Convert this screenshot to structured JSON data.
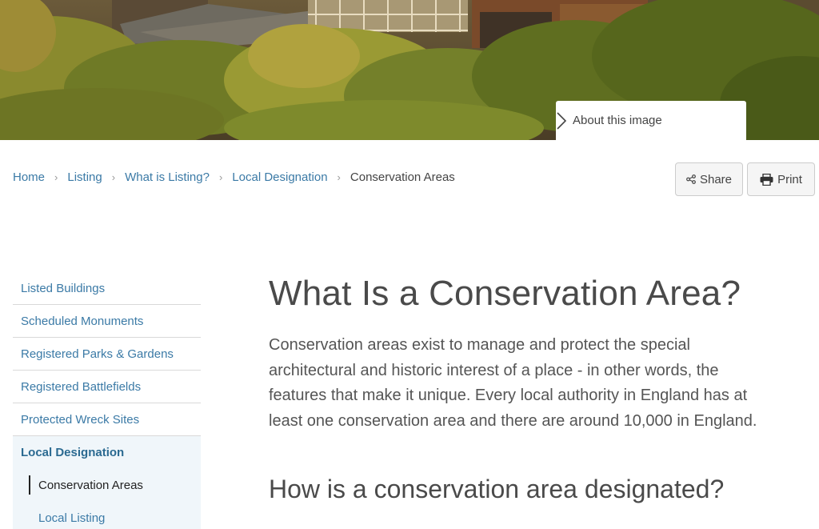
{
  "hero": {
    "about_label": "About this image",
    "chevron_icon": "chevron-right-icon"
  },
  "breadcrumb": {
    "items": [
      "Home",
      "Listing",
      "What is Listing?",
      "Local Designation"
    ],
    "current": "Conservation Areas"
  },
  "tools": {
    "share_label": "Share",
    "print_label": "Print",
    "share_icon": "share-icon",
    "print_icon": "printer-icon"
  },
  "sidebar": {
    "items": [
      "Listed Buildings",
      "Scheduled Monuments",
      "Registered Parks & Gardens",
      "Registered Battlefields",
      "Protected Wreck Sites"
    ],
    "active": "Local Designation",
    "sub_items": [
      "Conservation Areas",
      "Local Listing"
    ]
  },
  "main": {
    "title": "What Is a Conservation Area?",
    "intro": "Conservation areas exist to manage and protect the special architectural and historic interest of a place - in other words, the features that make it unique. Every local authority in England has at least one conservation area and there are around 10,000 in England.",
    "h2": "How is a conservation area designated?"
  },
  "colors": {
    "link": "#3b7aa6",
    "active_bg": "#f0f6fa"
  }
}
